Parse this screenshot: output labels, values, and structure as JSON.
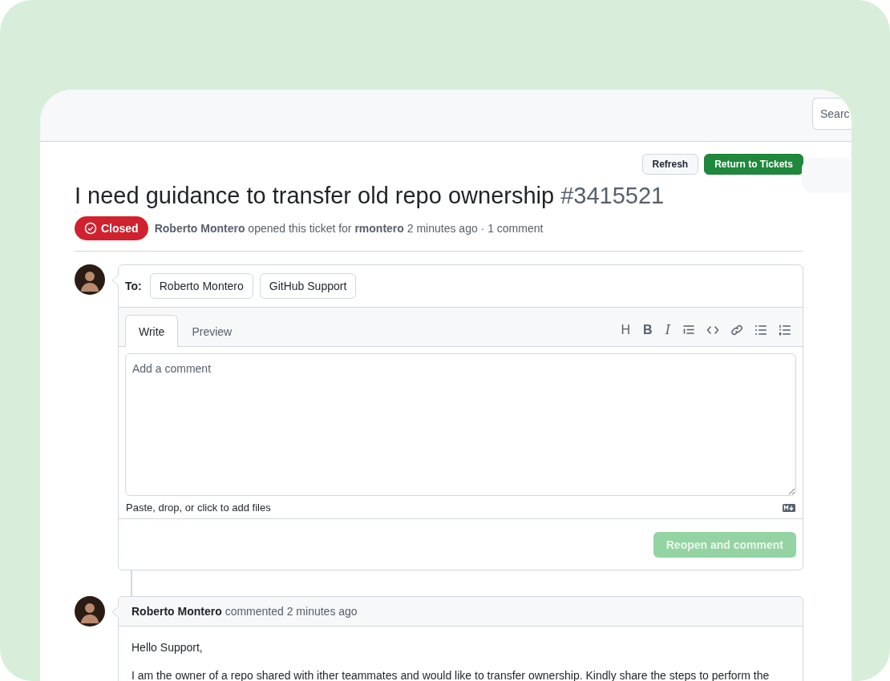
{
  "header": {
    "search": {
      "placeholder": "Searc"
    }
  },
  "actions": [
    {
      "label": "Refresh",
      "kind": "default"
    },
    {
      "label": "Return to Tickets",
      "kind": "primary"
    }
  ],
  "ticket": {
    "title": "I need guidance to transfer old repo ownership",
    "number": "#3415521",
    "status": "Closed",
    "author": "Roberto Montero",
    "opened_text": "opened this ticket for",
    "account": "rmontero",
    "time": "2 minutes ago · 1 comment"
  },
  "composer": {
    "to_label": "To:",
    "recipients": [
      "Roberto Montero",
      "GitHub Support"
    ],
    "tabs": [
      {
        "label": "Write",
        "selected": true
      },
      {
        "label": "Preview",
        "selected": false
      }
    ],
    "toolbar": [
      {
        "kind": "heading",
        "glyph": "H"
      },
      {
        "kind": "bold",
        "glyph": "B"
      },
      {
        "kind": "italic",
        "glyph": "I"
      },
      {
        "kind": "quote"
      },
      {
        "kind": "code"
      },
      {
        "kind": "link"
      },
      {
        "kind": "bullets"
      },
      {
        "kind": "numbers"
      }
    ],
    "placeholder": "Add a comment",
    "attach_hint": "Paste, drop, or click to add files",
    "submit": {
      "label": "Reopen and comment",
      "disabled": true
    }
  },
  "comments": [
    {
      "author": "Roberto Montero",
      "meta": "commented 2 minutes ago",
      "paragraphs": [
        "Hello Support,",
        "I am the owner of a repo shared with ither teammates and would like to transfer ownership. Kindly share the steps to perform the"
      ]
    }
  ]
}
